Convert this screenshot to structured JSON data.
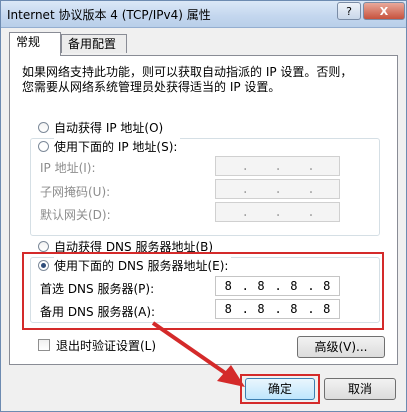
{
  "window": {
    "title": "Internet 协议版本 4 (TCP/IPv4) 属性",
    "help_label": "?",
    "close_label": "X"
  },
  "tabs": [
    {
      "label": "常规",
      "active": true
    },
    {
      "label": "备用配置",
      "active": false
    }
  ],
  "description": "如果网络支持此功能，则可以获取自动指派的 IP 设置。否则，\n您需要从网络系统管理员处获得适当的 IP 设置。",
  "ip_section": {
    "auto_label": "自动获得 IP 地址(O)",
    "manual_label": "使用下面的 IP 地址(S):",
    "fields": [
      {
        "label": "IP 地址(I):",
        "value": [
          "",
          "",
          "",
          ""
        ]
      },
      {
        "label": "子网掩码(U):",
        "value": [
          "",
          "",
          "",
          ""
        ]
      },
      {
        "label": "默认网关(D):",
        "value": [
          "",
          "",
          "",
          ""
        ]
      }
    ]
  },
  "dns_section": {
    "auto_label": "自动获得 DNS 服务器地址(B)",
    "manual_label": "使用下面的 DNS 服务器地址(E):",
    "preferred": {
      "label": "首选 DNS 服务器(P):",
      "value": [
        "8",
        "8",
        "8",
        "8"
      ]
    },
    "alternate": {
      "label": "备用 DNS 服务器(A):",
      "value": [
        "8",
        "8",
        "8",
        "8"
      ]
    }
  },
  "validate": {
    "label": "退出时验证设置(L)",
    "checked": false
  },
  "buttons": {
    "advanced": "高级(V)...",
    "ok": "确定",
    "cancel": "取消"
  },
  "colors": {
    "highlight": "#d42a2a",
    "accent": "#2f4d7a"
  }
}
